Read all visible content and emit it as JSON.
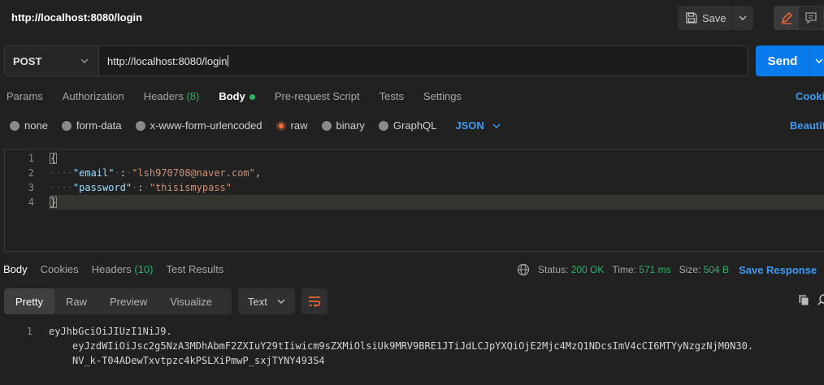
{
  "window": {
    "title": "http://localhost:8080/login"
  },
  "toolbar": {
    "save_label": "Save"
  },
  "request": {
    "method": "POST",
    "url": "http://localhost:8080/login",
    "send_label": "Send"
  },
  "request_tabs": [
    {
      "label": "Params"
    },
    {
      "label": "Authorization"
    },
    {
      "label": "Headers",
      "count": "(8)"
    },
    {
      "label": "Body"
    },
    {
      "label": "Pre-request Script"
    },
    {
      "label": "Tests"
    },
    {
      "label": "Settings"
    }
  ],
  "cookies_label": "Cookies",
  "body_types": [
    {
      "label": "none"
    },
    {
      "label": "form-data"
    },
    {
      "label": "x-www-form-urlencoded"
    },
    {
      "label": "raw"
    },
    {
      "label": "binary"
    },
    {
      "label": "GraphQL"
    }
  ],
  "body_language": "JSON",
  "beautify_label": "Beautify",
  "editor": {
    "line_numbers": [
      "1",
      "2",
      "3",
      "4"
    ],
    "open_brace": "{",
    "close_brace": "}",
    "email_key": "\"email\"",
    "email_value": "\"lsh970708@naver.com\"",
    "password_key": "\"password\"",
    "password_value": "\"thisismypass\""
  },
  "response_tabs": [
    {
      "label": "Body"
    },
    {
      "label": "Cookies"
    },
    {
      "label": "Headers",
      "count": "(10)"
    },
    {
      "label": "Test Results"
    }
  ],
  "response_status": {
    "status_label": "Status:",
    "status_value": "200 OK",
    "time_label": "Time:",
    "time_value": "571 ms",
    "size_label": "Size:",
    "size_value": "504 B",
    "save_response_label": "Save Response"
  },
  "view_modes": [
    {
      "label": "Pretty"
    },
    {
      "label": "Raw"
    },
    {
      "label": "Preview"
    },
    {
      "label": "Visualize"
    }
  ],
  "format_select": "Text",
  "response_body": {
    "line_number": "1",
    "lines": [
      "eyJhbGciOiJIUzI1NiJ9.",
      "eyJzdWIiOiJsc2g5NzA3MDhAbmF2ZXIuY29tIiwicm9sZXMiOlsiUk9MRV9BRE1JTiJdLCJpYXQiOjE2Mjc4MzQ1NDcsImV4cCI6MTYyNzgzNjM0N30.",
      "NV_k-T04ADewTxvtpzc4kPSLXiPmwP_sxjTYNY493S4"
    ]
  },
  "colors": {
    "accent": "#097bed",
    "link": "#3d9af5",
    "success": "#29b566",
    "raw_radio": "#ff6c37"
  },
  "icons": [
    "save-icon",
    "chevron-down-icon",
    "pencil-icon",
    "comment-icon",
    "globe-icon",
    "wrap-lines-icon",
    "copy-icon",
    "search-icon"
  ]
}
